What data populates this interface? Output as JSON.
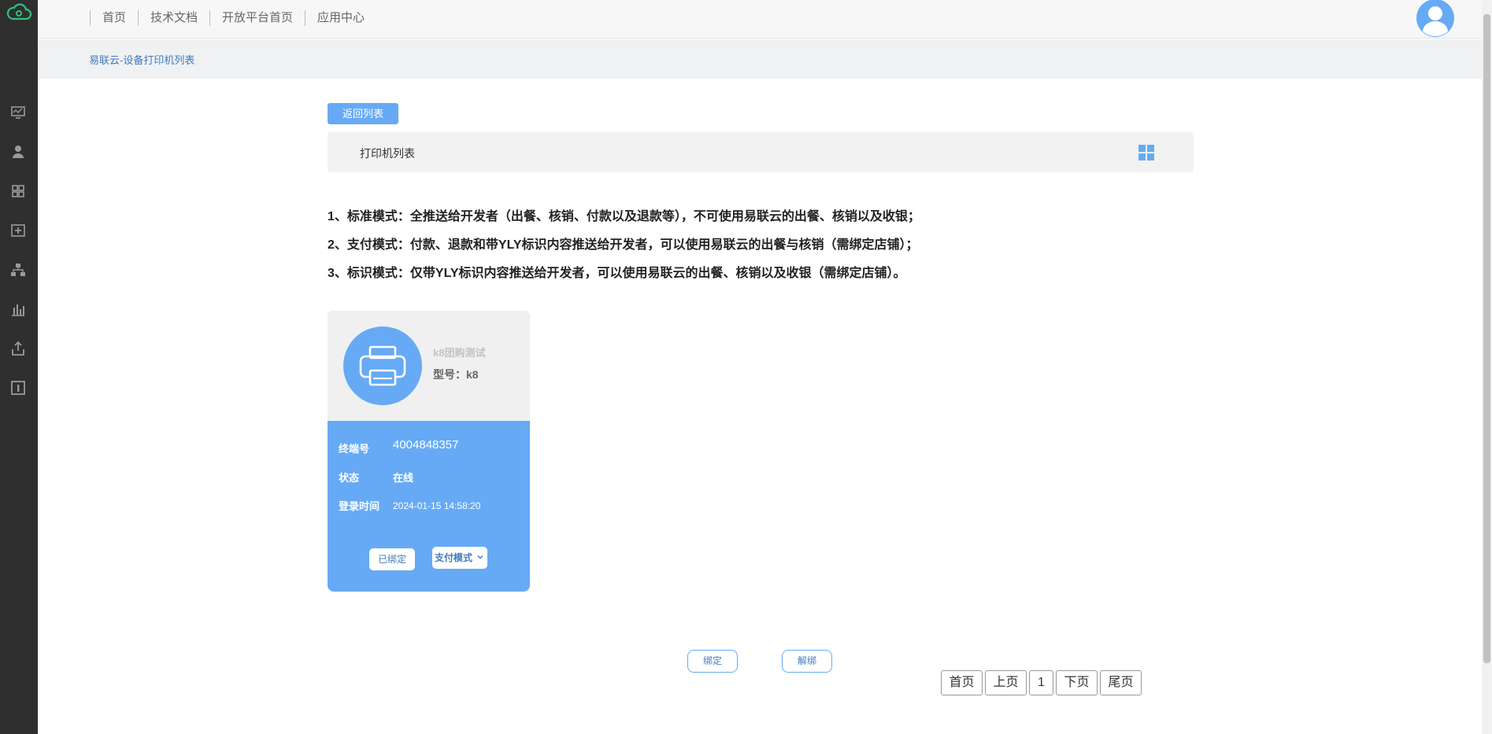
{
  "sidebar": {
    "logo_icon": "cloud-logo-icon",
    "items": [
      {
        "icon": "monitor-icon",
        "name": "sidebar-item-monitor"
      },
      {
        "icon": "user-icon",
        "name": "sidebar-item-user"
      },
      {
        "icon": "grid-apps-icon",
        "name": "sidebar-item-apps"
      },
      {
        "icon": "add-box-icon",
        "name": "sidebar-item-add"
      },
      {
        "icon": "org-tree-icon",
        "name": "sidebar-item-structure"
      },
      {
        "icon": "bar-chart-icon",
        "name": "sidebar-item-stats"
      },
      {
        "icon": "upload-icon",
        "name": "sidebar-item-upload"
      },
      {
        "icon": "info-box-icon",
        "name": "sidebar-item-info"
      }
    ]
  },
  "topnav": {
    "links": [
      "首页",
      "技术文档",
      "开放平台首页",
      "应用中心"
    ]
  },
  "breadcrumb": "易联云-设备打印机列表",
  "toolbar": {
    "back_label": "返回列表",
    "list_title": "打印机列表"
  },
  "notes": [
    "1、标准模式：全推送给开发者（出餐、核销、付款以及退款等），不可使用易联云的出餐、核销以及收银；",
    "2、支付模式：付款、退款和带YLY标识内容推送给开发者，可以使用易联云的出餐与核销（需绑定店铺）；",
    "3、标识模式：仅带YLY标识内容推送给开发者，可以使用易联云的出餐、核销以及收银（需绑定店铺）。"
  ],
  "device": {
    "name": "k8团购测试",
    "model": "型号：k8",
    "terminal_label": "终端号",
    "terminal_value": "4004848357",
    "status_label": "状态",
    "status_value": "在线",
    "login_label": "登录时间",
    "login_value": "2024-01-15 14:58:20",
    "bound_label": "已绑定",
    "mode_value": "支付模式"
  },
  "actions": {
    "bind_label": "绑定",
    "unbind_label": "解绑"
  },
  "pager": {
    "first": "首页",
    "prev": "上页",
    "page": "1",
    "next": "下页",
    "last": "尾页"
  },
  "colors": {
    "accent": "#66aaf5",
    "sidebar_bg": "#2f2f2f",
    "logo_green": "#2fc27a"
  }
}
